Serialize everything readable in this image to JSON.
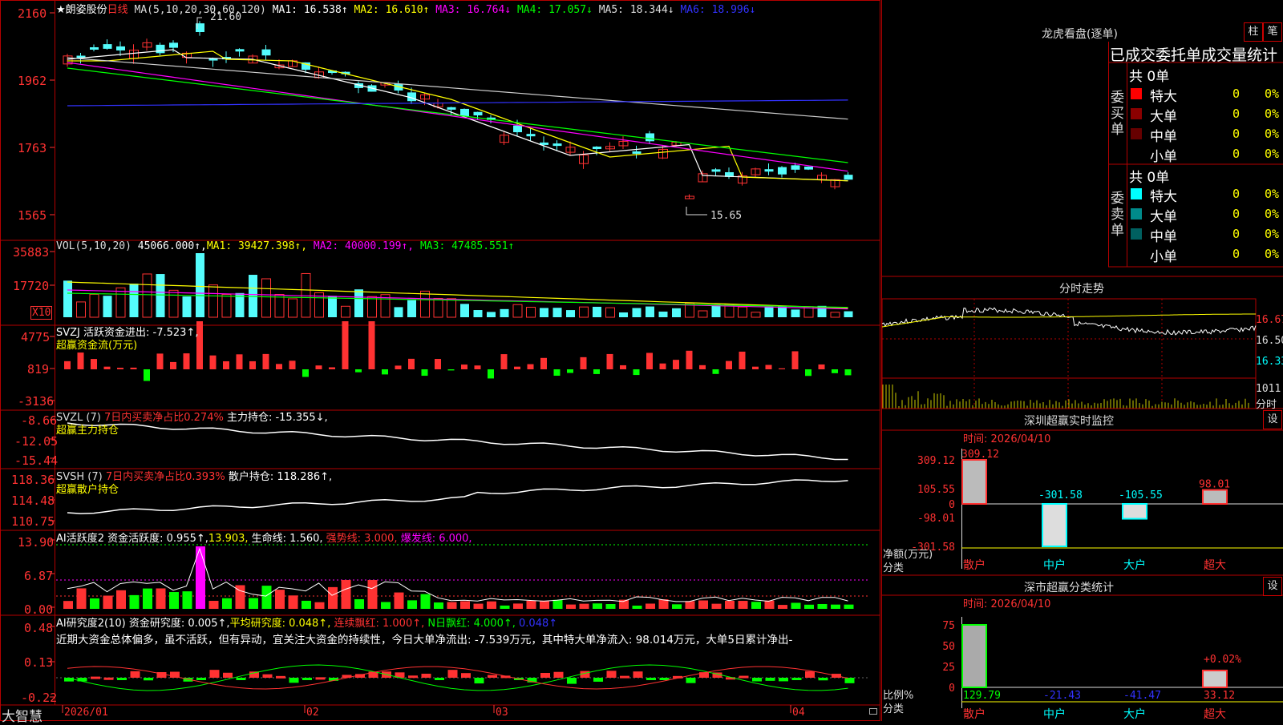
{
  "header": {
    "title": "★朗姿股份",
    "period": "日线",
    "ma_label": "MA(5,10,20,30,60,120)",
    "ma": [
      {
        "label": "MA1: 16.538↑",
        "color": "#ffffff"
      },
      {
        "label": "MA2: 16.610↑",
        "color": "#ffff00"
      },
      {
        "label": "MA3: 16.764↓",
        "color": "#ff00ff"
      },
      {
        "label": "MA4: 17.057↓",
        "color": "#00ff00"
      },
      {
        "label": "MA5: 18.344↓",
        "color": "#cccccc"
      },
      {
        "label": "MA6: 18.996↓",
        "color": "#0000ff"
      }
    ],
    "price_axis": [
      "2160",
      "1962",
      "1763",
      "1565"
    ],
    "high_label": "21.60",
    "low_label": "15.65"
  },
  "vol": {
    "title": "VOL(5,10,20)",
    "value": "45066.000↑,",
    "ma": [
      {
        "label": "MA1: 39427.398↑,",
        "color": "#ffff00"
      },
      {
        "label": "MA2: 40000.199↑,",
        "color": "#ff00ff"
      },
      {
        "label": "MA3: 47485.551↑",
        "color": "#00ff00"
      }
    ],
    "axis": [
      "35883",
      "17720"
    ],
    "unit": "X10"
  },
  "svzj": {
    "title": "SVZJ  活跃资金进出: -7.523↑,",
    "subtitle": "超赢资金流(万元)",
    "axis": [
      "4775",
      "819",
      "-3136"
    ]
  },
  "svzl": {
    "title_a": "SVZL (7) ",
    "title_b": "7日内买卖净占比0.274%",
    "title_c": " 主力持仓: -15.355↓,",
    "subtitle": "超赢主力持仓",
    "axis": [
      "-8.66",
      "-12.05",
      "-15.44"
    ]
  },
  "svsh": {
    "title_a": "SVSH (7) ",
    "title_b": "7日内买卖净占比0.393%",
    "title_c": " 散户持仓: 118.286↑,",
    "subtitle": "超赢散户持仓",
    "axis": [
      "118.36",
      "114.48",
      "110.75"
    ]
  },
  "ai1": {
    "title": "AI活跃度2 资金活跃度: 0.955↑,",
    "v1": "13.903,",
    "v2": "生命线: 1.560,",
    "v3": "强势线: 3.000,",
    "v4": "爆发线: 6.000,",
    "axis": [
      "13.90",
      "6.87",
      "0.00"
    ]
  },
  "ai2": {
    "title": "AI研究度2(10) 资金研究度: 0.005↑,",
    "v1": "平均研究度: 0.048↑,",
    "v2": "连续飘红: 1.000↑,",
    "v3": "N日飘红: 4.000↑,",
    "v4": "0.048↑",
    "comment": "近期大资金总体偏多，虽不活跃，但有异动，宜关注大资金的持续性，今日大单净流出: -7.539万元，其中特大单净流入: 98.014万元，大单5日累计净出-",
    "axis": [
      "0.48",
      "0.13",
      "-0.22"
    ]
  },
  "bottom": {
    "brand": "大智慧",
    "dates": [
      "2026/01",
      "02",
      "03",
      "04"
    ]
  },
  "dragon": {
    "title": "龙虎看盘(逐单)",
    "btn1": "柱",
    "btn2": "笔",
    "section": "已成交委托单成交量统计",
    "buy_label": "委买单",
    "sell_label": "委卖单",
    "buy_total": "共 0单",
    "sell_total": "共 0单",
    "buy_rows": [
      {
        "name": "特大",
        "count": "0",
        "pct": "0%",
        "color": "#ff0000"
      },
      {
        "name": "大单",
        "count": "0",
        "pct": "0%",
        "color": "#8b0000"
      },
      {
        "name": "中单",
        "count": "0",
        "pct": "0%",
        "color": "#660000"
      },
      {
        "name": "小单",
        "count": "0",
        "pct": "0%",
        "color": ""
      }
    ],
    "sell_rows": [
      {
        "name": "特大",
        "count": "0",
        "pct": "0%",
        "color": "#00ffff"
      },
      {
        "name": "大单",
        "count": "0",
        "pct": "0%",
        "color": "#008b8b"
      },
      {
        "name": "中单",
        "count": "0",
        "pct": "0%",
        "color": "#006060"
      },
      {
        "name": "小单",
        "count": "0",
        "pct": "0%",
        "color": ""
      }
    ]
  },
  "intraday": {
    "title": "分时走势",
    "axis": [
      "16.67",
      "16.50",
      "16.33"
    ],
    "vol_label": "1011",
    "vol_unit": "分时"
  },
  "sz_monitor": {
    "title": "深圳超赢实时监控",
    "btn": "设",
    "time": "时间: 2026/04/10",
    "axis": [
      "309.12",
      "105.55",
      "0",
      "-98.01",
      "-301.58"
    ],
    "ylabel": "净额(万元)",
    "xlabel": "分类",
    "categories": [
      "散户",
      "中户",
      "大户",
      "超大"
    ],
    "values": [
      309.12,
      -301.58,
      -105.55,
      98.01
    ],
    "value_labels": [
      "309.12",
      "-301.58",
      "-105.55",
      "98.01"
    ]
  },
  "sz_class": {
    "title": "深市超赢分类统计",
    "btn": "设",
    "time": "时间: 2026/04/10",
    "axis": [
      "75",
      "50",
      "25",
      "0"
    ],
    "ylabel": "比例%",
    "xlabel": "分类",
    "categories": [
      "散户",
      "中户",
      "大户",
      "超大"
    ],
    "values": [
      129.79,
      -21.43,
      -41.47,
      33.12
    ],
    "value_labels": [
      "129.79",
      "-21.43",
      "-41.47",
      "33.12"
    ],
    "bar_pcts": [
      100,
      0,
      0,
      27
    ],
    "note": "+0.02%"
  },
  "colors": {
    "up": "#ff3232",
    "down": "#54fcfc",
    "frame": "#b40000",
    "green": "#00ff00"
  }
}
